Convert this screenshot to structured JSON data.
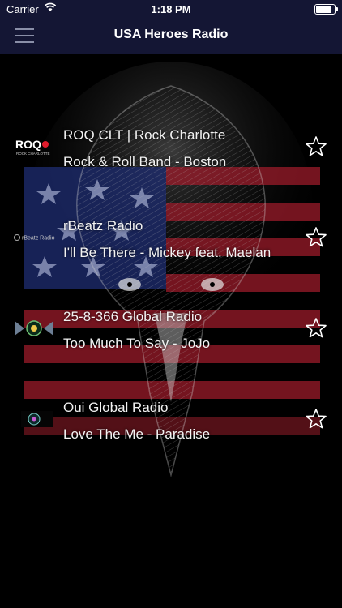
{
  "status_bar": {
    "carrier": "Carrier",
    "time": "1:18 PM"
  },
  "nav": {
    "title": "USA Heroes Radio",
    "menu_icon": "hamburger-menu-icon"
  },
  "colors": {
    "nav_background": "#141634",
    "text": "#ffffff",
    "flag_red": "#9b1b2a",
    "flag_blue": "#1d2a6b"
  },
  "stations": [
    {
      "name": "ROQ CLT | Rock Charlotte",
      "track": "Rock & Roll Band - Boston",
      "logo_text": "ROQ",
      "logo_subtext": "ROCK CHARLOTTE",
      "favorite": false
    },
    {
      "name": "rBeatz Radio",
      "track": "I'll Be There - Mickey feat. Maelan",
      "logo_text": "rBeatz Radio",
      "favorite": false
    },
    {
      "name": "25-8-366 Global Radio",
      "track": "Too Much To Say - JoJo",
      "logo_text": "",
      "favorite": false
    },
    {
      "name": "Oui Global Radio",
      "track": "Love The Me - Paradise",
      "logo_text": "",
      "favorite": false
    }
  ]
}
